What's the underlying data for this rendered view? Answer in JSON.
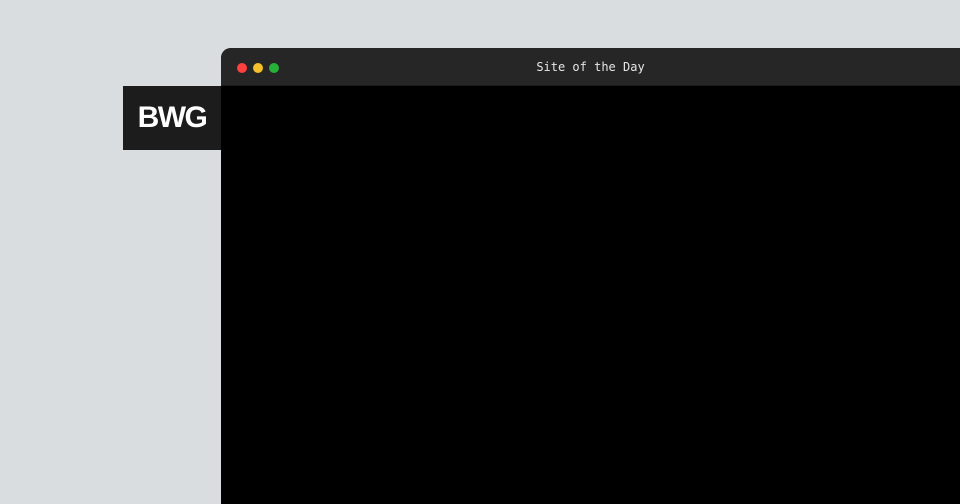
{
  "logo": {
    "text": "BWG"
  },
  "window": {
    "title": "Site of the Day",
    "controls": [
      {
        "name": "close",
        "color": "#ff4040"
      },
      {
        "name": "minimize",
        "color": "#f5c02a"
      },
      {
        "name": "maximize",
        "color": "#28b13a"
      }
    ]
  },
  "colors": {
    "background": "#d9dddf",
    "logo_tile": "#1c1c1c",
    "titlebar": "#262626",
    "content": "#000000"
  }
}
